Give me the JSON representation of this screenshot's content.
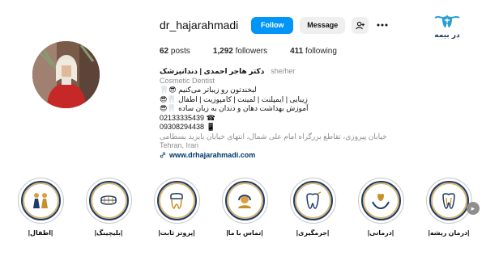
{
  "logo": {
    "text": "در بیمه"
  },
  "profile": {
    "username": "dr_hajarahmadi",
    "follow_label": "Follow",
    "message_label": "Message",
    "stats": {
      "posts": "62",
      "posts_label": "posts",
      "followers": "1,292",
      "followers_label": "followers",
      "following": "411",
      "following_label": "following"
    },
    "full_name": "دکتر هاجر احمدی | دندانپزشک",
    "pronouns": "she/her",
    "category": "Cosmetic Dentist",
    "bio_lines": [
      "لبخندتون رو زیباتر می‌کنیم",
      "زیبایی | ایمپلنت | لمینت | کامپوزیت | اطفال",
      "آموزش بهداشت دهان و دندان به زبان ساده",
      "02133335439",
      "09308294438"
    ],
    "address": "خیابان پیروزی، تقاطع بزرگراه امام علی شمال، انتهای خیابان بایزید بسطامی",
    "city": "Tehran, Iran",
    "website": "www.drhajarahmadi.com"
  },
  "highlights": [
    {
      "label": "|اطفال|"
    },
    {
      "label": "|بلیچینگ|"
    },
    {
      "label": "|پروتز ثابت|"
    },
    {
      "label": "|تماس با ما|"
    },
    {
      "label": "|جرمگیری|"
    },
    {
      "label": "|درمانی|"
    },
    {
      "label": "|درمان ریشه|"
    }
  ],
  "colors": {
    "accent": "#0095f6",
    "ring_navy": "#1f3b6c",
    "ring_gold": "#d8b870"
  }
}
